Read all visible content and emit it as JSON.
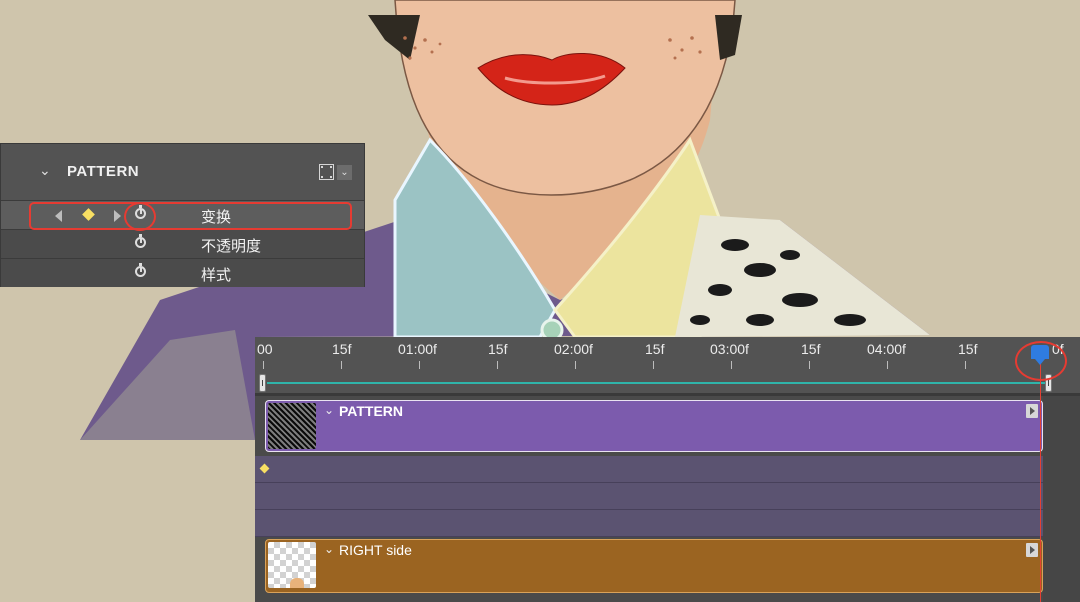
{
  "layers_panel": {
    "layer_name": "PATTERN",
    "properties": [
      {
        "label": "变换",
        "has_keyframe": true,
        "selected": true
      },
      {
        "label": "不透明度",
        "has_keyframe": false,
        "selected": false
      },
      {
        "label": "样式",
        "has_keyframe": false,
        "selected": false
      }
    ]
  },
  "timeline": {
    "ruler_labels": [
      "00",
      "15f",
      "01:00f",
      "15f",
      "02:00f",
      "15f",
      "03:00f",
      "15f",
      "04:00f",
      "15f",
      "0f"
    ],
    "tracks": [
      {
        "name": "PATTERN",
        "color": "#7c5bad"
      },
      {
        "name": "RIGHT side",
        "color": "#9b6421"
      }
    ]
  },
  "colors": {
    "highlight": "#e63b32",
    "playhead": "#2f7ce0",
    "keyframe": "#f8df63",
    "work_area": "#2fb4aa"
  }
}
